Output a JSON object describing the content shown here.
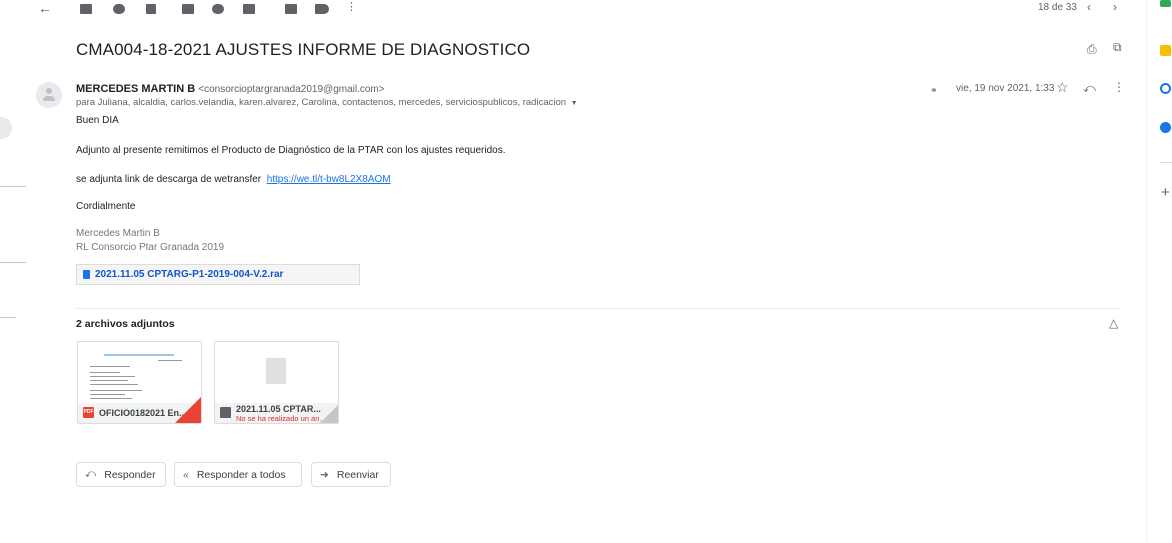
{
  "toolbar": {
    "pagination": "18 de 33"
  },
  "email": {
    "subject": "CMA004-18-2021 AJUSTES INFORME DE DIAGNOSTICO",
    "sender_name": "MERCEDES MARTIN B",
    "sender_email": "<consorcioptargranada2019@gmail.com>",
    "recipients": "para Juliana, alcaldia, carlos.velandia, karen.alvarez, Carolina, contactenos, mercedes, serviciospublicos, radicacion",
    "date": "vie, 19 nov 2021, 1:33",
    "greeting": "Buen DIA",
    "paragraph": "Adjunto al presente remitimos el Producto de Diagnóstico de la PTAR con los ajustes requeridos.",
    "link_prefix": "se adjunta link de descarga de wetransfer",
    "link": "https://we.tl/t-bw8L2X8AOM",
    "closing": "Cordialmente",
    "signature_name": "Mercedes Martin B",
    "signature_title": "RL Consorcio Ptar Granada 2019"
  },
  "inline_attachment": {
    "name": "2021.11.05 CPTARG-P1-2019-004-V.2.rar"
  },
  "attachments": {
    "heading": "2 archivos adjuntos",
    "items": [
      {
        "type_badge": "PDF",
        "name": "OFICIO0182021 En...",
        "status": ""
      },
      {
        "type_badge": "",
        "name": "2021.11.05 CPTAR...",
        "status": "No se ha realizado un an..."
      }
    ]
  },
  "actions": {
    "reply": "Responder",
    "reply_all": "Responder a todos",
    "forward": "Reenviar"
  },
  "colors": {
    "accent": "#1a73e8",
    "pdf_red": "#ea4335",
    "warning_red": "#d93025"
  }
}
